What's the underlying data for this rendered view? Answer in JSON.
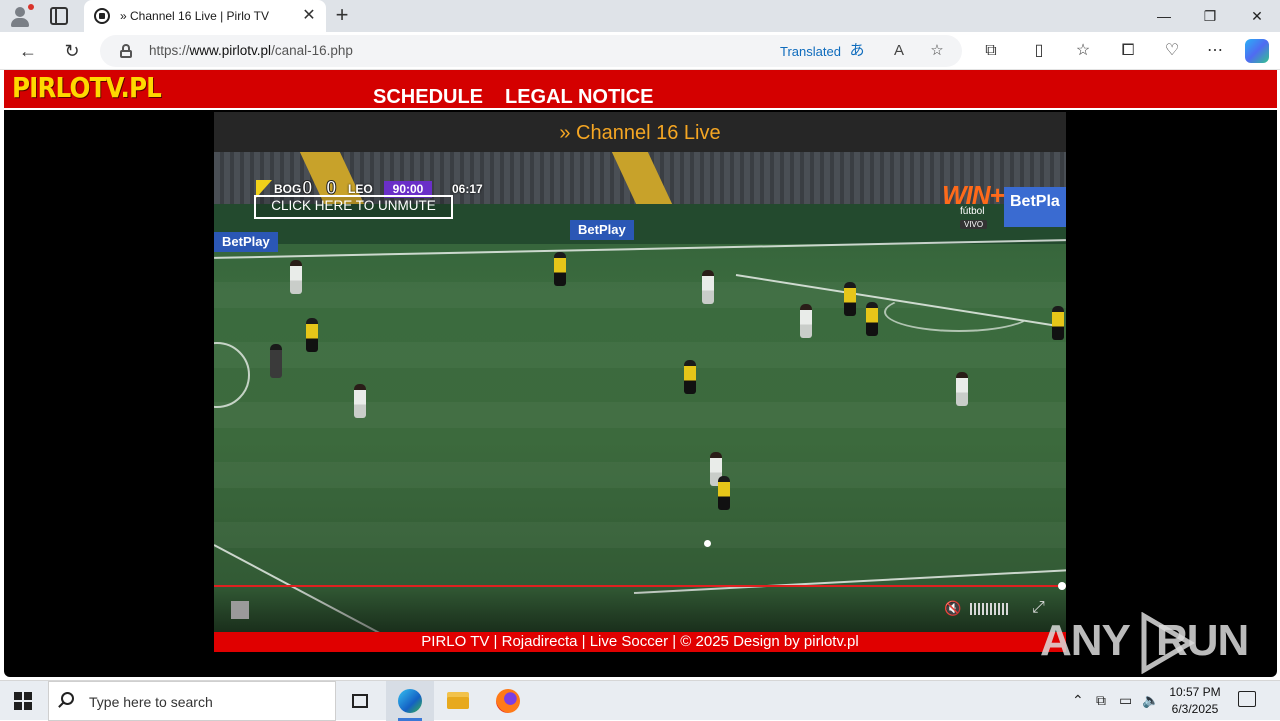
{
  "browser": {
    "tab_title": "» Channel 16 Live | Pirlo TV",
    "new_tab": "+",
    "url_prefix": "https://",
    "url_host": "www.pirlotv.pl",
    "url_path": "/canal-16.php",
    "translated_label": "Translated",
    "window_minimize": "—",
    "window_restore": "❐",
    "window_close": "✕"
  },
  "site": {
    "logo": "PIRLOTV.PL",
    "menu": [
      "SCHEDULE",
      "LEGAL NOTICE"
    ],
    "channel_title": "» Channel 16 Live",
    "footer": "PIRLO TV | Rojadirecta | Live Soccer | © 2025 Design by pirlotv.pl"
  },
  "player": {
    "home_team": "BOG",
    "home_score": "0",
    "away_score": "0",
    "away_team": "LEO",
    "match_time": "90:00",
    "stoppage_clock": "06:17",
    "unmute_label": "CLICK HERE TO UNMUTE",
    "broadcaster": "WIN+",
    "broadcaster_sub": "fútbol",
    "broadcaster_live": "VIVO",
    "boards": [
      "BetPlay",
      "BetPlay",
      "BetPla"
    ],
    "progress": 1.0
  },
  "watermark": {
    "text_left": "ANY",
    "text_right": "RUN"
  },
  "taskbar": {
    "search_placeholder": "Type here to search",
    "time": "10:57 PM",
    "date": "6/3/2025"
  },
  "icons": {
    "back": "back-arrow-icon",
    "refresh": "refresh-icon",
    "lock": "lock-icon",
    "read_aloud": "read-aloud-icon",
    "favorite": "star-icon",
    "extensions": "puzzle-icon",
    "split_screen": "split-screen-icon",
    "favorites": "favorites-icon",
    "collections": "collections-icon",
    "more": "more-icon"
  },
  "colors": {
    "site_red": "#d40000",
    "logo_yellow": "#ffd800",
    "title_orange": "#f5a623",
    "edge_blue": "#0f6cbd"
  }
}
